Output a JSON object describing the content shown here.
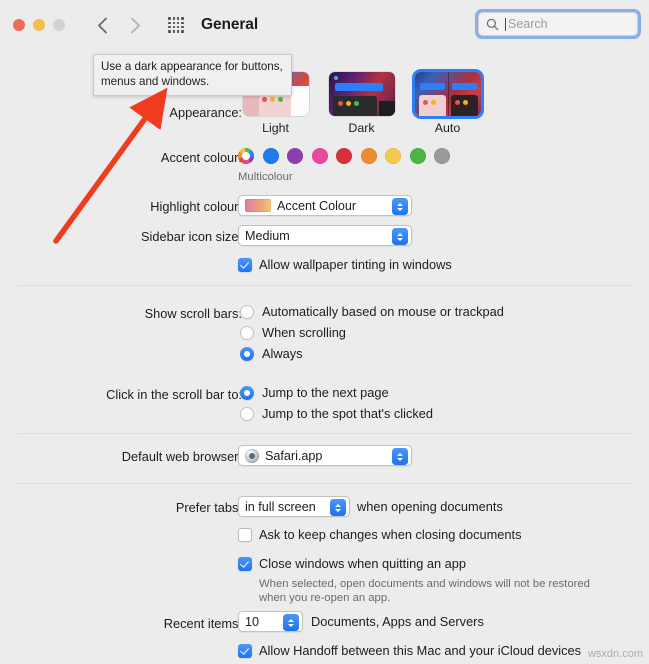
{
  "window": {
    "title": "General",
    "traffic_lights": [
      "close",
      "minimize",
      "zoom"
    ]
  },
  "search": {
    "placeholder": "Search",
    "value": ""
  },
  "tooltip": {
    "text": "Use a dark appearance for buttons, menus and windows."
  },
  "appearance": {
    "label": "Appearance:",
    "options": [
      {
        "label": "Light",
        "selected": false
      },
      {
        "label": "Dark",
        "selected": false
      },
      {
        "label": "Auto",
        "selected": true
      }
    ]
  },
  "accent_colour": {
    "label": "Accent colour:",
    "selected_name": "Multicolour",
    "swatches": [
      {
        "name": "Multicolour",
        "color": "multi",
        "selected": true
      },
      {
        "name": "Blue",
        "color": "#1f7ceb",
        "selected": false
      },
      {
        "name": "Purple",
        "color": "#8e3fae",
        "selected": false
      },
      {
        "name": "Pink",
        "color": "#e8499c",
        "selected": false
      },
      {
        "name": "Red",
        "color": "#d8313c",
        "selected": false
      },
      {
        "name": "Orange",
        "color": "#ec8b34",
        "selected": false
      },
      {
        "name": "Yellow",
        "color": "#f5cb4f",
        "selected": false
      },
      {
        "name": "Green",
        "color": "#4cb548",
        "selected": false
      },
      {
        "name": "Graphite",
        "color": "#9a9a9a",
        "selected": false
      }
    ]
  },
  "highlight_colour": {
    "label": "Highlight colour:",
    "value": "Accent Colour"
  },
  "sidebar_icon_size": {
    "label": "Sidebar icon size:",
    "value": "Medium"
  },
  "wallpaper_tinting": {
    "label": "Allow wallpaper tinting in windows",
    "checked": true
  },
  "show_scroll_bars": {
    "label": "Show scroll bars:",
    "options": [
      {
        "label": "Automatically based on mouse or trackpad",
        "selected": false
      },
      {
        "label": "When scrolling",
        "selected": false
      },
      {
        "label": "Always",
        "selected": true
      }
    ]
  },
  "click_scroll_bar": {
    "label": "Click in the scroll bar to:",
    "options": [
      {
        "label": "Jump to the next page",
        "selected": true
      },
      {
        "label": "Jump to the spot that's clicked",
        "selected": false
      }
    ]
  },
  "default_web_browser": {
    "label": "Default web browser:",
    "value": "Safari.app"
  },
  "prefer_tabs": {
    "label": "Prefer tabs:",
    "value": "in full screen",
    "suffix": "when opening documents"
  },
  "ask_keep_changes": {
    "label": "Ask to keep changes when closing documents",
    "checked": false
  },
  "close_windows": {
    "label": "Close windows when quitting an app",
    "checked": true,
    "help": "When selected, open documents and windows will not be restored when you re-open an app."
  },
  "recent_items": {
    "label": "Recent items:",
    "value": "10",
    "suffix": "Documents, Apps and Servers"
  },
  "handoff": {
    "label": "Allow Handoff between this Mac and your iCloud devices",
    "checked": true
  },
  "watermark": {
    "text": "wsxdn.com"
  },
  "colors": {
    "accent_blue": "#2d7ff9",
    "background": "#ececec",
    "divider": "#dcdcdc",
    "annotation_arrow": "#ef3b1e"
  }
}
